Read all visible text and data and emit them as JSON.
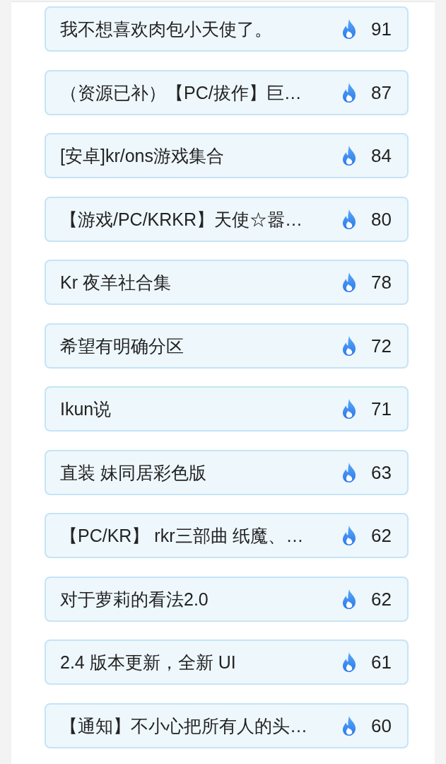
{
  "posts": [
    {
      "title": "我不想喜欢肉包小天使了。",
      "heat": "91"
    },
    {
      "title": "（资源已补）【PC/拔作】巨…",
      "heat": "87"
    },
    {
      "title": "[安卓]kr/ons游戏集合",
      "heat": "84"
    },
    {
      "title": "【游戏/PC/KRKR】天使☆嚣…",
      "heat": "80"
    },
    {
      "title": "Kr 夜羊社合集",
      "heat": "78"
    },
    {
      "title": "希望有明确分区",
      "heat": "72"
    },
    {
      "title": "Ikun说",
      "heat": "71"
    },
    {
      "title": "直装 妹同居彩色版",
      "heat": "63"
    },
    {
      "title": "【PC/KR】 rkr三部曲 纸魔、…",
      "heat": "62"
    },
    {
      "title": "对于萝莉的看法2.0",
      "heat": "62"
    },
    {
      "title": "2.4 版本更新，全新 UI",
      "heat": "61"
    },
    {
      "title": "【通知】不小心把所有人的头…",
      "heat": "60"
    }
  ]
}
